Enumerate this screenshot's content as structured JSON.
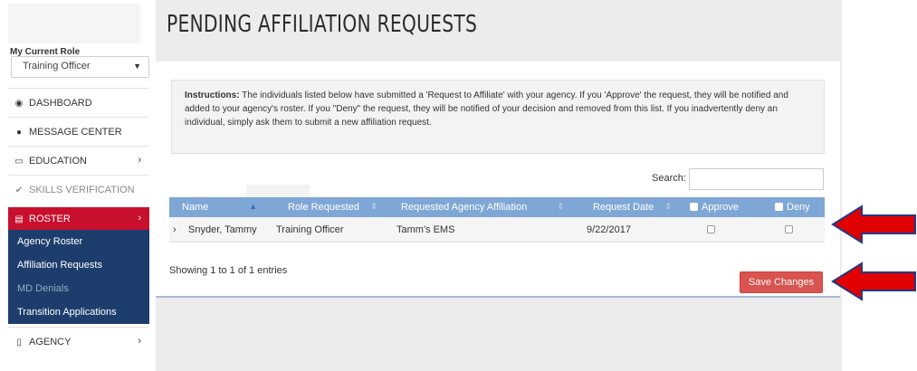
{
  "sidebar": {
    "role_label": "My Current Role",
    "role_value": "Training Officer",
    "items": [
      {
        "label": "DASHBOARD",
        "icon": "dashboard-icon"
      },
      {
        "label": "MESSAGE CENTER",
        "icon": "chat-bubble-icon"
      },
      {
        "label": "EDUCATION",
        "icon": "monitor-icon"
      },
      {
        "label": "SKILLS VERIFICATION",
        "icon": "checkmark-icon"
      },
      {
        "label": "ROSTER",
        "icon": "list-icon"
      },
      {
        "label": "AGENCY",
        "icon": "building-icon"
      }
    ],
    "roster_sub": [
      {
        "label": "Agency Roster"
      },
      {
        "label": "Affiliation Requests"
      },
      {
        "label": "MD Denials"
      },
      {
        "label": "Transition Applications"
      }
    ]
  },
  "main": {
    "title": "Pending Affiliation Requests",
    "instructions_bold": "Instructions:",
    "instructions_text": " The individuals listed below have submitted a 'Request to Affiliate' with your agency. If you 'Approve' the request, they will be notified and added to your agency's roster. If you \"Deny\" the request, they will be notified of your decision and removed from this list. If you inadvertently deny an individual, simply ask them to submit a new affiliation request.",
    "search_label": "Search:",
    "columns": [
      "Name",
      "Role Requested",
      "Requested Agency Affiliation",
      "Request Date",
      "Approve",
      "Deny"
    ],
    "rows": [
      {
        "expand": "›",
        "name": "Snyder, Tammy",
        "role": "Training Officer",
        "agency": "Tamm's EMS",
        "date": "9/22/2017"
      }
    ],
    "showing": "Showing 1 to 1 of 1 entries",
    "save_label": "Save Changes"
  },
  "colors": {
    "roster_red": "#c8102e",
    "submenu_blue": "#1d3e6d",
    "table_header": "#7fa7d6",
    "save_button": "#d9534f",
    "arrow_red": "#e00000",
    "arrow_outline": "#1f3a8a"
  }
}
